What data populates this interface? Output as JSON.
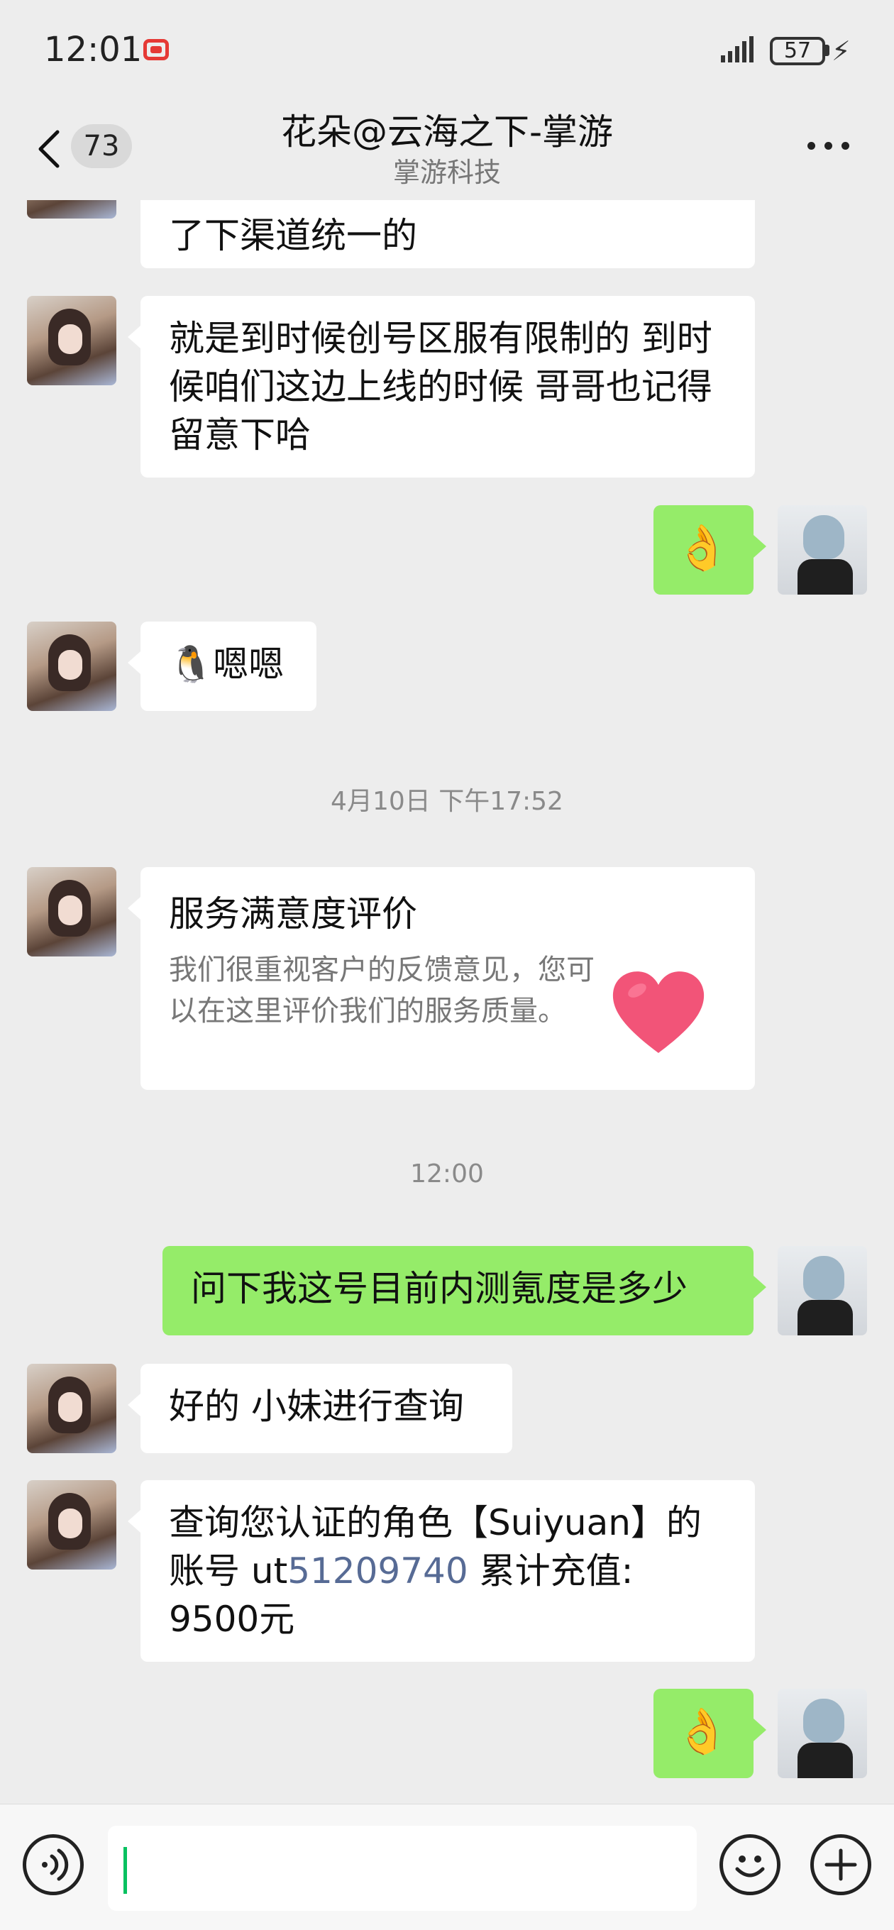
{
  "status_bar": {
    "time": "12:01",
    "battery": "57"
  },
  "header": {
    "unread_count": "73",
    "title": "花朵@云海之下-掌游",
    "subtitle": "掌游科技"
  },
  "messages": {
    "m1": "了下渠道统一的",
    "m2": "就是到时候创号区服有限制的 到时候咱们这边上线的时候 哥哥也记得留意下哈",
    "m3_emoji": "👌",
    "m4_emoji": "🐧",
    "m4_text": "嗯嗯",
    "ts1": "4月10日 下午17:52",
    "card": {
      "title": "服务满意度评价",
      "desc": "我们很重视客户的反馈意见，您可以在这里评价我们的服务质量。"
    },
    "ts2": "12:00",
    "m5": "问下我这号目前内测氪度是多少",
    "m6": "好的 小妹进行查询",
    "m7": {
      "part1": "查询您认证的角色【Suiyuan】的账号 ut",
      "link": "51209740",
      "part2": " 累计充值: 9500元"
    },
    "m8_emoji": "👌"
  },
  "input": {
    "value": ""
  },
  "colors": {
    "outgoing_bubble": "#95ec69",
    "incoming_bubble": "#ffffff",
    "background": "#ededed",
    "link": "#576b95",
    "heart": "#f25478"
  }
}
